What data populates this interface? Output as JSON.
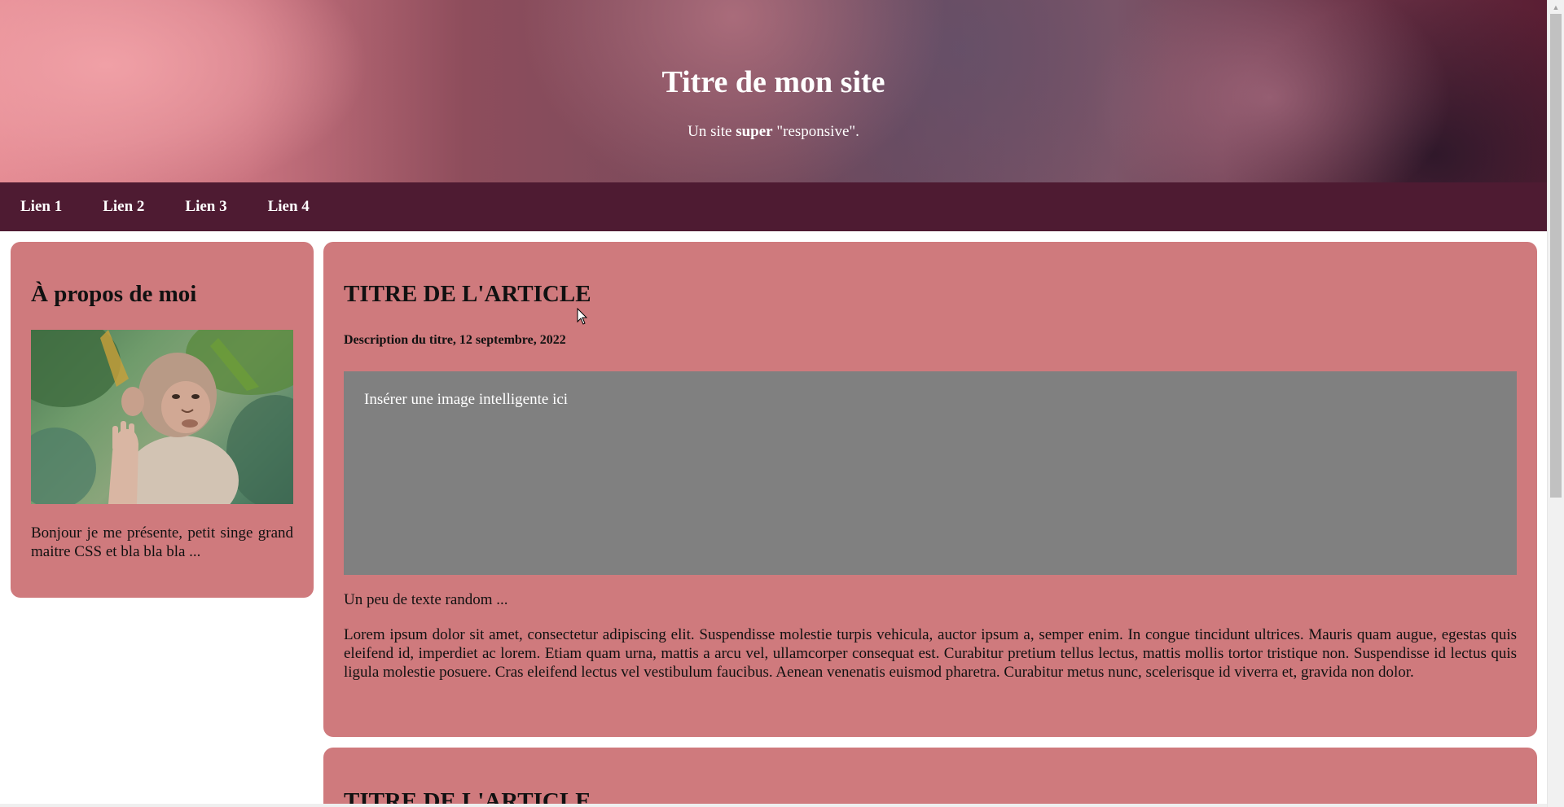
{
  "header": {
    "title": "Titre de mon site",
    "tagline_before": "Un site ",
    "tagline_bold": "super",
    "tagline_after": " \"responsive\"."
  },
  "nav": {
    "links": [
      "Lien 1",
      "Lien 2",
      "Lien 3",
      "Lien 4"
    ]
  },
  "sidebar": {
    "title": "À propos de moi",
    "image_subject": "monkey-photo",
    "text": "Bonjour je me présente, petit singe grand maitre CSS et bla bla bla ..."
  },
  "articles": [
    {
      "title": "TITRE DE L'ARTICLE",
      "meta": "Description du titre, 12 septembre, 2022",
      "image_placeholder": "Insérer une image intelligente ici",
      "lead": "Un peu de texte random ...",
      "body": "Lorem ipsum dolor sit amet, consectetur adipiscing elit. Suspendisse molestie turpis vehicula, auctor ipsum a, semper enim. In congue tincidunt ultrices. Mauris quam augue, egestas quis eleifend id, imperdiet ac lorem. Etiam quam urna, mattis a arcu vel, ullamcorper consequat est. Curabitur pretium tellus lectus, mattis mollis tortor tristique non. Suspendisse id lectus quis ligula molestie posuere. Cras eleifend lectus vel vestibulum faucibus. Aenean venenatis euismod pharetra. Curabitur metus nunc, scelerisque id viverra et, gravida non dolor."
    },
    {
      "title": "TITRE DE L'ARTICLE"
    }
  ],
  "colors": {
    "nav_bg": "#4e1b32",
    "card_bg": "#cf7a7d",
    "placeholder_bg": "#808080"
  }
}
